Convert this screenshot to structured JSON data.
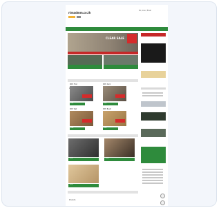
{
  "header": {
    "logo_text": "rtmadmm.co.th",
    "contact_text": "Tel / Line / Email"
  },
  "nav": {
    "items": [
      "Home",
      "Products",
      "Promotion",
      "About",
      "Contact"
    ]
  },
  "banner": {
    "headline": "CLEAR SALE"
  },
  "sections": {
    "products_title": "Products",
    "tiles_title": "Products",
    "bottom_title": "Products"
  },
  "products": [
    {
      "name": "WPC Floor",
      "button": "View"
    },
    {
      "name": "WPC Deck",
      "button": "View"
    },
    {
      "name": "WPC Wall",
      "button": "View"
    },
    {
      "name": "WPC Board",
      "button": "View"
    }
  ],
  "tiles": [
    {
      "button": "View"
    },
    {
      "button": "View"
    },
    {
      "button": "View"
    }
  ],
  "colors": {
    "brand_green": "#2e8b3c",
    "accent_red": "#c62828",
    "price_red": "#d52b2b",
    "background": "#f3f6fb"
  }
}
